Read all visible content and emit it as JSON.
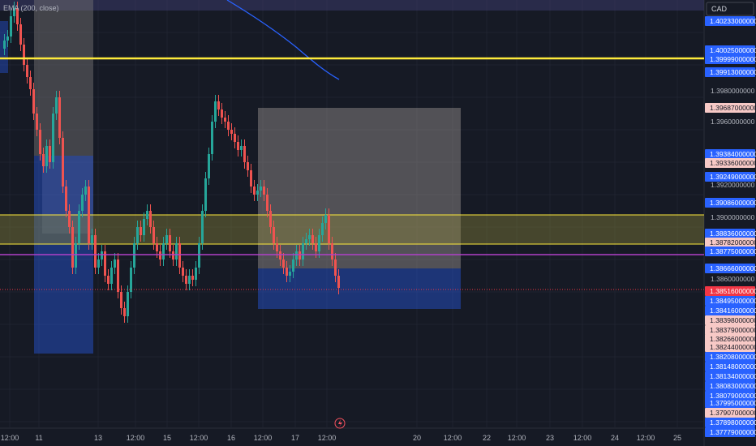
{
  "indicator": {
    "label": "EMA (200, close)"
  },
  "currency": "CAD",
  "chart_data": {
    "type": "candlestick",
    "y_axis_ticks": [
      "1.3980000000",
      "1.3960000000",
      "1.3920000000",
      "1.3900000000",
      "1.3860000000"
    ],
    "price_labels": [
      {
        "text": "1.40233000000",
        "color": "#2962ff"
      },
      {
        "text": "1.40025000000",
        "color": "#2962ff"
      },
      {
        "text": "1.39999000000",
        "color": "#2962ff"
      },
      {
        "text": "1.39913000000",
        "color": "#2962ff"
      },
      {
        "text": "1.39687000000",
        "color": "#f7c9c6"
      },
      {
        "text": "1.39384000000",
        "color": "#2962ff"
      },
      {
        "text": "1.39336000000",
        "color": "#f7c9c6"
      },
      {
        "text": "1.39249000000",
        "color": "#2962ff"
      },
      {
        "text": "1.39086000000",
        "color": "#2962ff"
      },
      {
        "text": "1.38836000000",
        "color": "#2962ff"
      },
      {
        "text": "1.38782000000",
        "color": "#f7c9c6"
      },
      {
        "text": "1.38775000000",
        "color": "#2962ff"
      },
      {
        "text": "1.38666000000",
        "color": "#2962ff"
      },
      {
        "text": "1.38516000000",
        "color": "#f23645"
      },
      {
        "text": "1.38495000000",
        "color": "#2962ff"
      },
      {
        "text": "1.38416000000",
        "color": "#2962ff"
      },
      {
        "text": "1.38398000000",
        "color": "#f7c9c6"
      },
      {
        "text": "1.38379000000",
        "color": "#f7c9c6"
      },
      {
        "text": "1.38266000000",
        "color": "#f7c9c6"
      },
      {
        "text": "1.38244000000",
        "color": "#f7c9c6"
      },
      {
        "text": "1.38208000000",
        "color": "#2962ff"
      },
      {
        "text": "1.38148000000",
        "color": "#2962ff"
      },
      {
        "text": "1.38134000000",
        "color": "#2962ff"
      },
      {
        "text": "1.38083000000",
        "color": "#2962ff"
      },
      {
        "text": "1.38079000000",
        "color": "#2962ff"
      },
      {
        "text": "1.37995000000",
        "color": "#2962ff"
      },
      {
        "text": "1.37907000000",
        "color": "#f7c9c6"
      },
      {
        "text": "1.37898000000",
        "color": "#2962ff"
      },
      {
        "text": "1.37779000000",
        "color": "#2962ff"
      }
    ],
    "x_ticks": [
      "12:00",
      "11",
      "13",
      "12:00",
      "15",
      "12:00",
      "16",
      "12:00",
      "17",
      "12:00",
      "20",
      "12:00",
      "22",
      "12:00",
      "23",
      "12:00",
      "24",
      "12:00",
      "25"
    ],
    "horizontal_lines": [
      {
        "price": 1.39999,
        "color": "#ffeb3b"
      },
      {
        "price": 1.38775,
        "color": "#b040c8"
      },
      {
        "price": 1.38516,
        "color": "#f23645"
      }
    ],
    "zones": [
      {
        "top": 1.3897,
        "bottom": 1.38782,
        "color": "#ffeb3b"
      }
    ],
    "colors": {
      "up": "#26a69a",
      "down": "#ef5350",
      "ema": "#2962ff",
      "background": "#161a25"
    }
  }
}
